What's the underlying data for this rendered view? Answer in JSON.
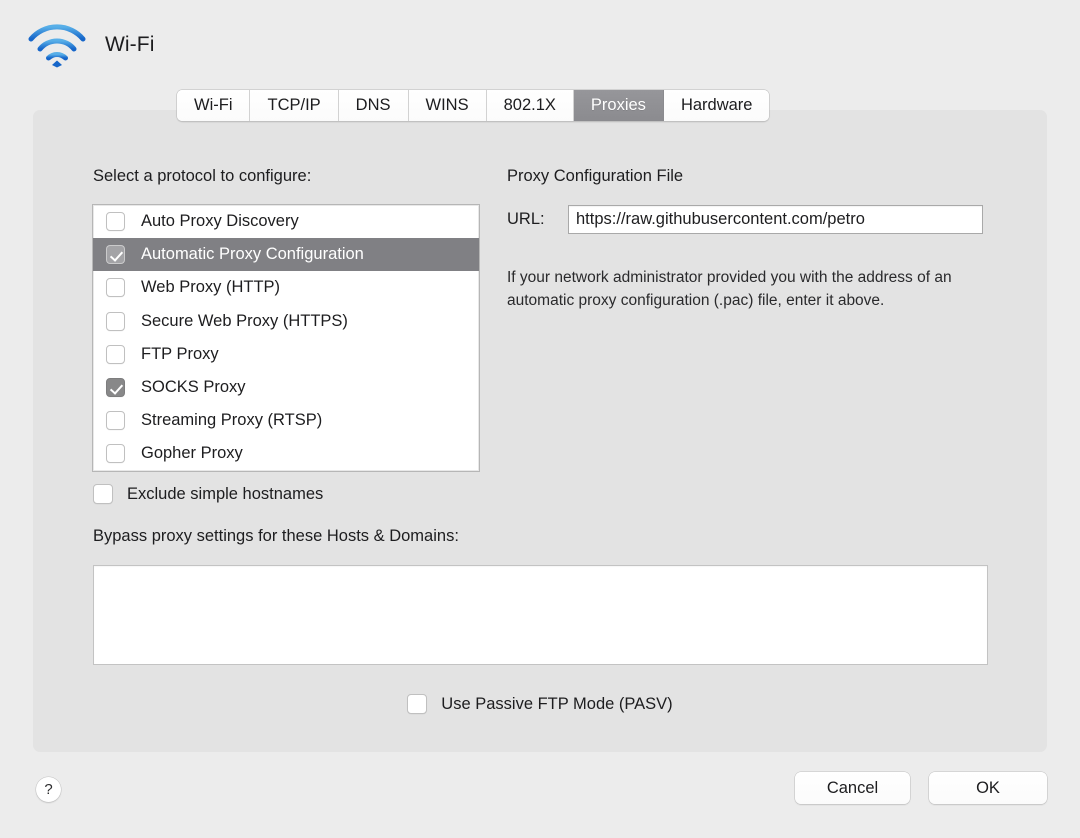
{
  "header": {
    "title": "Wi-Fi",
    "icon": "wifi-icon"
  },
  "tabs": [
    {
      "label": "Wi-Fi",
      "selected": false
    },
    {
      "label": "TCP/IP",
      "selected": false
    },
    {
      "label": "DNS",
      "selected": false
    },
    {
      "label": "WINS",
      "selected": false
    },
    {
      "label": "802.1X",
      "selected": false
    },
    {
      "label": "Proxies",
      "selected": true
    },
    {
      "label": "Hardware",
      "selected": false
    }
  ],
  "proxies": {
    "list_label": "Select a protocol to configure:",
    "protocols": [
      {
        "label": "Auto Proxy Discovery",
        "checked": false,
        "selected": false
      },
      {
        "label": "Automatic Proxy Configuration",
        "checked": true,
        "selected": true
      },
      {
        "label": "Web Proxy (HTTP)",
        "checked": false,
        "selected": false
      },
      {
        "label": "Secure Web Proxy (HTTPS)",
        "checked": false,
        "selected": false
      },
      {
        "label": "FTP Proxy",
        "checked": false,
        "selected": false
      },
      {
        "label": "SOCKS Proxy",
        "checked": true,
        "selected": false
      },
      {
        "label": "Streaming Proxy (RTSP)",
        "checked": false,
        "selected": false
      },
      {
        "label": "Gopher Proxy",
        "checked": false,
        "selected": false
      }
    ],
    "pac_title": "Proxy Configuration File",
    "url_label": "URL:",
    "url_value": "https://raw.githubusercontent.com/petro",
    "url_placeholder": "",
    "pac_help": "If your network administrator provided you with the address of an automatic proxy configuration (.pac) file, enter it above.",
    "exclude_simple_hostnames": {
      "label": "Exclude simple hostnames",
      "checked": false
    },
    "bypass_label": "Bypass proxy settings for these Hosts & Domains:",
    "bypass_value": "",
    "passive_ftp": {
      "label": "Use Passive FTP Mode (PASV)",
      "checked": false
    }
  },
  "footer": {
    "help_label": "?",
    "cancel_label": "Cancel",
    "ok_label": "OK"
  },
  "colors": {
    "window_bg": "#ececec",
    "panel_bg": "#e3e3e3",
    "tab_selected_bg": "#8b8b8f",
    "row_selected_bg": "#808084",
    "checkbox_checked_bg": "#888889",
    "wifi_blue": "#1a85de"
  }
}
